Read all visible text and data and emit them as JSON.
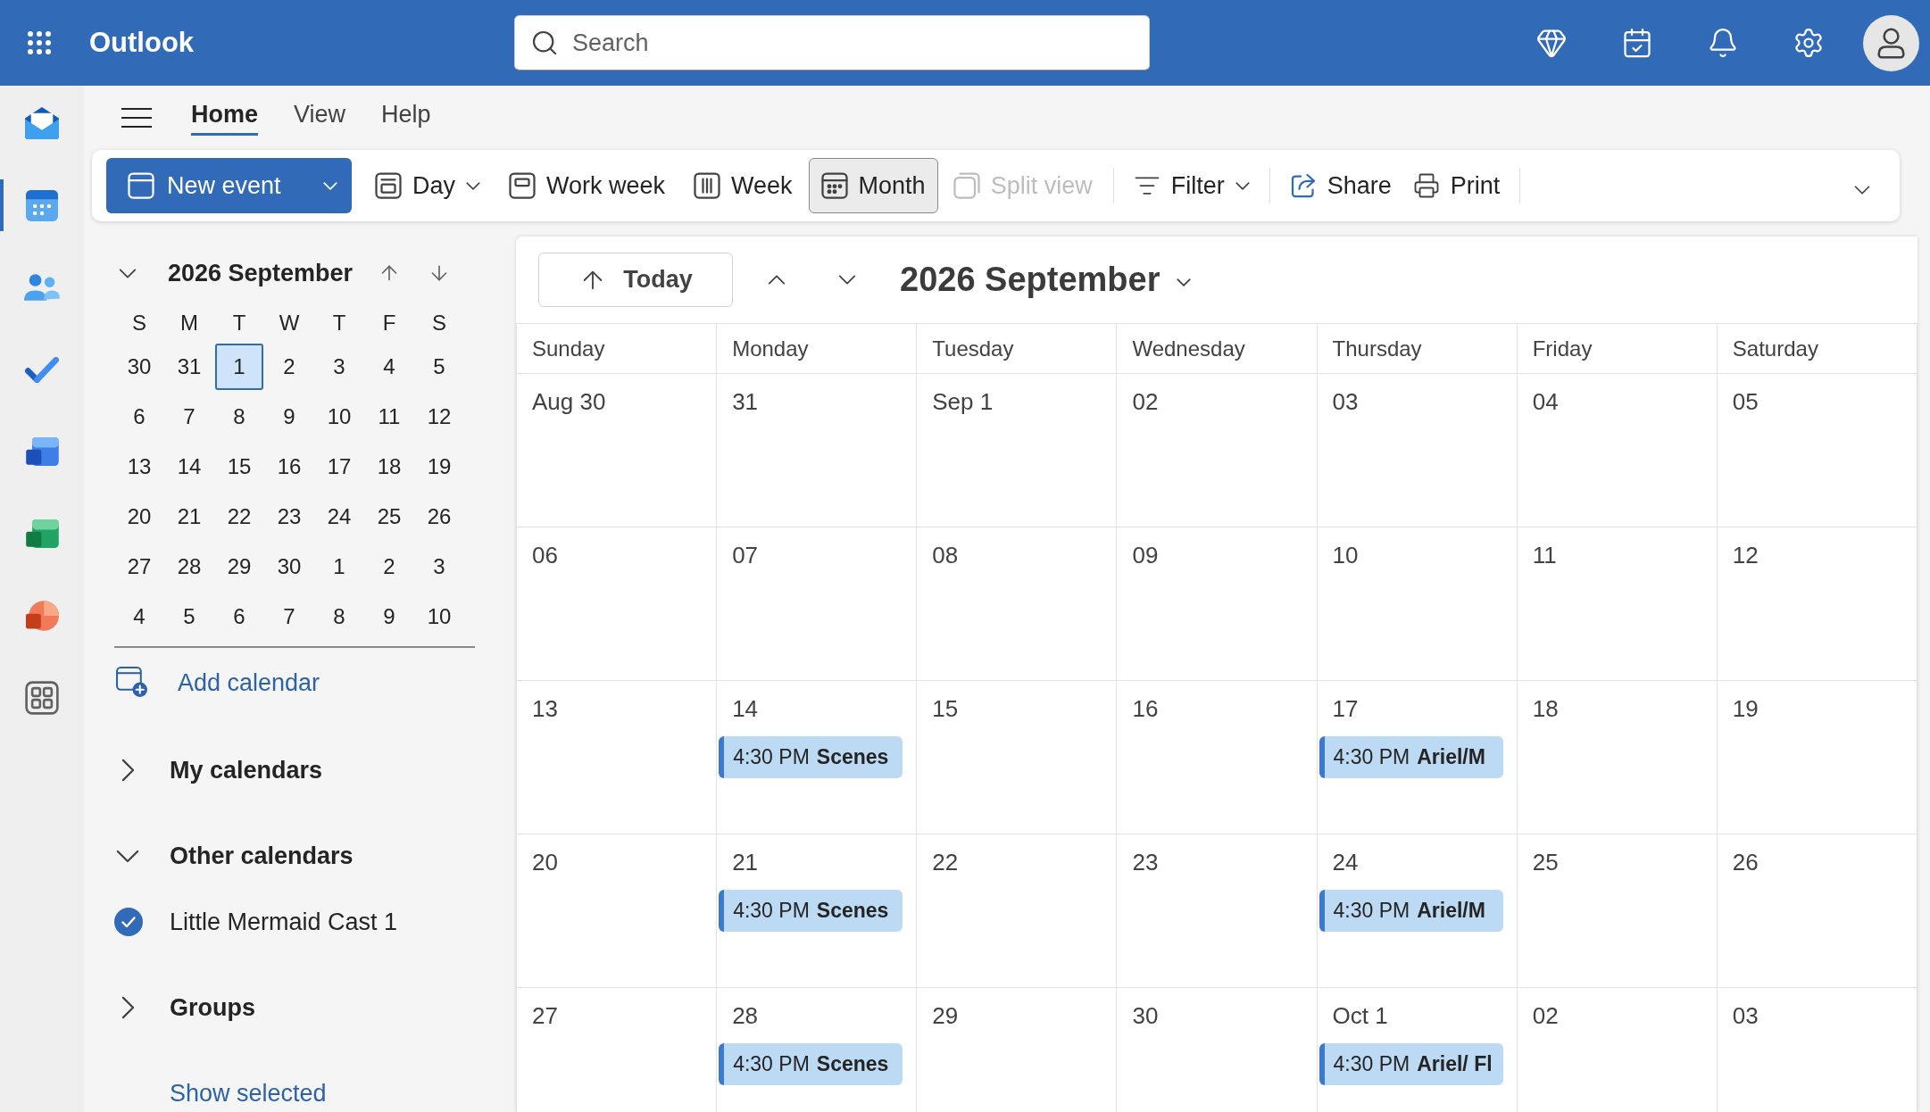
{
  "top_bar": {
    "app_name": "Outlook",
    "search": {
      "placeholder": "Search"
    }
  },
  "app_rail": [
    {
      "selected": false
    },
    {
      "selected": true
    },
    {
      "selected": false
    },
    {
      "selected": false
    },
    {
      "selected": false
    },
    {
      "selected": false
    },
    {
      "selected": false
    },
    {
      "selected": false
    }
  ],
  "tabs": [
    {
      "label": "Home",
      "selected": true
    },
    {
      "label": "View",
      "selected": false
    },
    {
      "label": "Help",
      "selected": false
    }
  ],
  "toolbar": {
    "new_event": {
      "label": "New event"
    },
    "views": [
      {
        "label": "Day",
        "selected": false,
        "dropdown": true
      },
      {
        "label": "Work week",
        "selected": false,
        "dropdown": false
      },
      {
        "label": "Week",
        "selected": false,
        "dropdown": false
      },
      {
        "label": "Month",
        "selected": true,
        "dropdown": false
      }
    ],
    "split_view": {
      "label": "Split view",
      "disabled": true
    },
    "filter": {
      "label": "Filter"
    },
    "actions": [
      {
        "label": "Share"
      },
      {
        "label": "Print"
      }
    ]
  },
  "mini_calendar": {
    "title": "2026 September",
    "weekdays": [
      "S",
      "M",
      "T",
      "W",
      "T",
      "F",
      "S"
    ],
    "weeks": [
      [
        {
          "day": "30",
          "selected": false
        },
        {
          "day": "31",
          "selected": false
        },
        {
          "day": "1",
          "selected": true
        },
        {
          "day": "2",
          "selected": false
        },
        {
          "day": "3",
          "selected": false
        },
        {
          "day": "4",
          "selected": false
        },
        {
          "day": "5",
          "selected": false
        }
      ],
      [
        {
          "day": "6",
          "selected": false
        },
        {
          "day": "7",
          "selected": false
        },
        {
          "day": "8",
          "selected": false
        },
        {
          "day": "9",
          "selected": false
        },
        {
          "day": "10",
          "selected": false
        },
        {
          "day": "11",
          "selected": false
        },
        {
          "day": "12",
          "selected": false
        }
      ],
      [
        {
          "day": "13",
          "selected": false
        },
        {
          "day": "14",
          "selected": false
        },
        {
          "day": "15",
          "selected": false
        },
        {
          "day": "16",
          "selected": false
        },
        {
          "day": "17",
          "selected": false
        },
        {
          "day": "18",
          "selected": false
        },
        {
          "day": "19",
          "selected": false
        }
      ],
      [
        {
          "day": "20",
          "selected": false
        },
        {
          "day": "21",
          "selected": false
        },
        {
          "day": "22",
          "selected": false
        },
        {
          "day": "23",
          "selected": false
        },
        {
          "day": "24",
          "selected": false
        },
        {
          "day": "25",
          "selected": false
        },
        {
          "day": "26",
          "selected": false
        }
      ],
      [
        {
          "day": "27",
          "selected": false
        },
        {
          "day": "28",
          "selected": false
        },
        {
          "day": "29",
          "selected": false
        },
        {
          "day": "30",
          "selected": false
        },
        {
          "day": "1",
          "selected": false
        },
        {
          "day": "2",
          "selected": false
        },
        {
          "day": "3",
          "selected": false
        }
      ],
      [
        {
          "day": "4",
          "selected": false
        },
        {
          "day": "5",
          "selected": false
        },
        {
          "day": "6",
          "selected": false
        },
        {
          "day": "7",
          "selected": false
        },
        {
          "day": "8",
          "selected": false
        },
        {
          "day": "9",
          "selected": false
        },
        {
          "day": "10",
          "selected": false
        }
      ]
    ]
  },
  "calendar_list": {
    "add_calendar": "Add calendar",
    "sections": [
      {
        "label": "My calendars",
        "expanded": false
      },
      {
        "label": "Other calendars",
        "expanded": true,
        "children": [
          {
            "label": "Little Mermaid Cast 1",
            "checked": true
          }
        ]
      },
      {
        "label": "Groups",
        "expanded": false
      }
    ],
    "show_selected": "Show selected"
  },
  "calendar": {
    "today_button": "Today",
    "title": "2026 September",
    "weekdays": [
      "Sunday",
      "Monday",
      "Tuesday",
      "Wednesday",
      "Thursday",
      "Friday",
      "Saturday"
    ],
    "weeks": [
      [
        {
          "date": "Aug 30"
        },
        {
          "date": "31"
        },
        {
          "date": "Sep 1"
        },
        {
          "date": "02"
        },
        {
          "date": "03"
        },
        {
          "date": "04"
        },
        {
          "date": "05"
        }
      ],
      [
        {
          "date": "06"
        },
        {
          "date": "07"
        },
        {
          "date": "08"
        },
        {
          "date": "09"
        },
        {
          "date": "10"
        },
        {
          "date": "11"
        },
        {
          "date": "12"
        }
      ],
      [
        {
          "date": "13"
        },
        {
          "date": "14",
          "events": [
            {
              "time": "4:30 PM",
              "title": "Scenes"
            }
          ]
        },
        {
          "date": "15"
        },
        {
          "date": "16"
        },
        {
          "date": "17",
          "events": [
            {
              "time": "4:30 PM",
              "title": "Ariel/M"
            }
          ]
        },
        {
          "date": "18"
        },
        {
          "date": "19"
        }
      ],
      [
        {
          "date": "20"
        },
        {
          "date": "21",
          "events": [
            {
              "time": "4:30 PM",
              "title": "Scenes"
            }
          ]
        },
        {
          "date": "22"
        },
        {
          "date": "23"
        },
        {
          "date": "24",
          "events": [
            {
              "time": "4:30 PM",
              "title": "Ariel/M"
            }
          ]
        },
        {
          "date": "25"
        },
        {
          "date": "26"
        }
      ],
      [
        {
          "date": "27"
        },
        {
          "date": "28",
          "events": [
            {
              "time": "4:30 PM",
              "title": "Scenes"
            }
          ]
        },
        {
          "date": "29"
        },
        {
          "date": "30"
        },
        {
          "date": "Oct 1",
          "events": [
            {
              "time": "4:30 PM",
              "title": "Ariel/ Fl"
            }
          ]
        },
        {
          "date": "02"
        },
        {
          "date": "03"
        }
      ]
    ]
  }
}
